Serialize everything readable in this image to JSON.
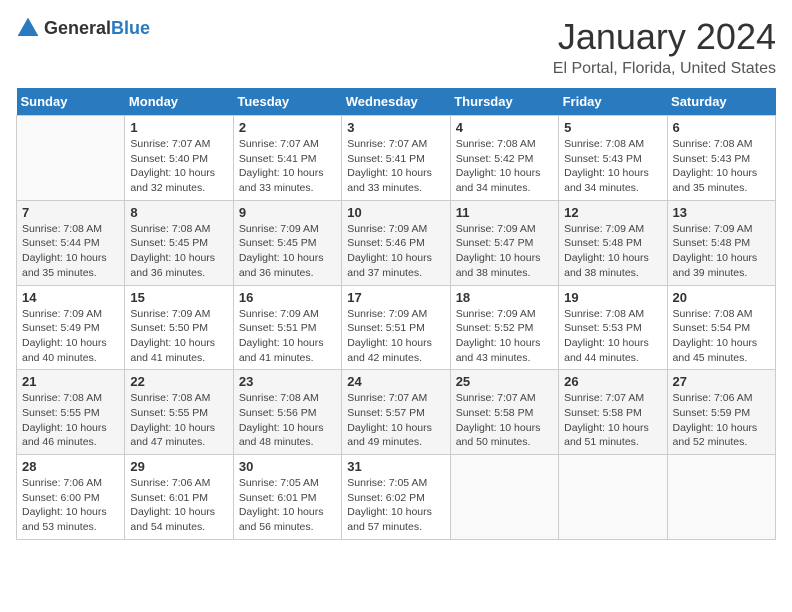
{
  "header": {
    "logo": {
      "text_general": "General",
      "text_blue": "Blue"
    },
    "title": "January 2024",
    "subtitle": "El Portal, Florida, United States"
  },
  "weekdays": [
    "Sunday",
    "Monday",
    "Tuesday",
    "Wednesday",
    "Thursday",
    "Friday",
    "Saturday"
  ],
  "weeks": [
    [
      {
        "day": "",
        "info": ""
      },
      {
        "day": "1",
        "info": "Sunrise: 7:07 AM\nSunset: 5:40 PM\nDaylight: 10 hours\nand 32 minutes."
      },
      {
        "day": "2",
        "info": "Sunrise: 7:07 AM\nSunset: 5:41 PM\nDaylight: 10 hours\nand 33 minutes."
      },
      {
        "day": "3",
        "info": "Sunrise: 7:07 AM\nSunset: 5:41 PM\nDaylight: 10 hours\nand 33 minutes."
      },
      {
        "day": "4",
        "info": "Sunrise: 7:08 AM\nSunset: 5:42 PM\nDaylight: 10 hours\nand 34 minutes."
      },
      {
        "day": "5",
        "info": "Sunrise: 7:08 AM\nSunset: 5:43 PM\nDaylight: 10 hours\nand 34 minutes."
      },
      {
        "day": "6",
        "info": "Sunrise: 7:08 AM\nSunset: 5:43 PM\nDaylight: 10 hours\nand 35 minutes."
      }
    ],
    [
      {
        "day": "7",
        "info": "Sunrise: 7:08 AM\nSunset: 5:44 PM\nDaylight: 10 hours\nand 35 minutes."
      },
      {
        "day": "8",
        "info": "Sunrise: 7:08 AM\nSunset: 5:45 PM\nDaylight: 10 hours\nand 36 minutes."
      },
      {
        "day": "9",
        "info": "Sunrise: 7:09 AM\nSunset: 5:45 PM\nDaylight: 10 hours\nand 36 minutes."
      },
      {
        "day": "10",
        "info": "Sunrise: 7:09 AM\nSunset: 5:46 PM\nDaylight: 10 hours\nand 37 minutes."
      },
      {
        "day": "11",
        "info": "Sunrise: 7:09 AM\nSunset: 5:47 PM\nDaylight: 10 hours\nand 38 minutes."
      },
      {
        "day": "12",
        "info": "Sunrise: 7:09 AM\nSunset: 5:48 PM\nDaylight: 10 hours\nand 38 minutes."
      },
      {
        "day": "13",
        "info": "Sunrise: 7:09 AM\nSunset: 5:48 PM\nDaylight: 10 hours\nand 39 minutes."
      }
    ],
    [
      {
        "day": "14",
        "info": "Sunrise: 7:09 AM\nSunset: 5:49 PM\nDaylight: 10 hours\nand 40 minutes."
      },
      {
        "day": "15",
        "info": "Sunrise: 7:09 AM\nSunset: 5:50 PM\nDaylight: 10 hours\nand 41 minutes."
      },
      {
        "day": "16",
        "info": "Sunrise: 7:09 AM\nSunset: 5:51 PM\nDaylight: 10 hours\nand 41 minutes."
      },
      {
        "day": "17",
        "info": "Sunrise: 7:09 AM\nSunset: 5:51 PM\nDaylight: 10 hours\nand 42 minutes."
      },
      {
        "day": "18",
        "info": "Sunrise: 7:09 AM\nSunset: 5:52 PM\nDaylight: 10 hours\nand 43 minutes."
      },
      {
        "day": "19",
        "info": "Sunrise: 7:08 AM\nSunset: 5:53 PM\nDaylight: 10 hours\nand 44 minutes."
      },
      {
        "day": "20",
        "info": "Sunrise: 7:08 AM\nSunset: 5:54 PM\nDaylight: 10 hours\nand 45 minutes."
      }
    ],
    [
      {
        "day": "21",
        "info": "Sunrise: 7:08 AM\nSunset: 5:55 PM\nDaylight: 10 hours\nand 46 minutes."
      },
      {
        "day": "22",
        "info": "Sunrise: 7:08 AM\nSunset: 5:55 PM\nDaylight: 10 hours\nand 47 minutes."
      },
      {
        "day": "23",
        "info": "Sunrise: 7:08 AM\nSunset: 5:56 PM\nDaylight: 10 hours\nand 48 minutes."
      },
      {
        "day": "24",
        "info": "Sunrise: 7:07 AM\nSunset: 5:57 PM\nDaylight: 10 hours\nand 49 minutes."
      },
      {
        "day": "25",
        "info": "Sunrise: 7:07 AM\nSunset: 5:58 PM\nDaylight: 10 hours\nand 50 minutes."
      },
      {
        "day": "26",
        "info": "Sunrise: 7:07 AM\nSunset: 5:58 PM\nDaylight: 10 hours\nand 51 minutes."
      },
      {
        "day": "27",
        "info": "Sunrise: 7:06 AM\nSunset: 5:59 PM\nDaylight: 10 hours\nand 52 minutes."
      }
    ],
    [
      {
        "day": "28",
        "info": "Sunrise: 7:06 AM\nSunset: 6:00 PM\nDaylight: 10 hours\nand 53 minutes."
      },
      {
        "day": "29",
        "info": "Sunrise: 7:06 AM\nSunset: 6:01 PM\nDaylight: 10 hours\nand 54 minutes."
      },
      {
        "day": "30",
        "info": "Sunrise: 7:05 AM\nSunset: 6:01 PM\nDaylight: 10 hours\nand 56 minutes."
      },
      {
        "day": "31",
        "info": "Sunrise: 7:05 AM\nSunset: 6:02 PM\nDaylight: 10 hours\nand 57 minutes."
      },
      {
        "day": "",
        "info": ""
      },
      {
        "day": "",
        "info": ""
      },
      {
        "day": "",
        "info": ""
      }
    ]
  ]
}
